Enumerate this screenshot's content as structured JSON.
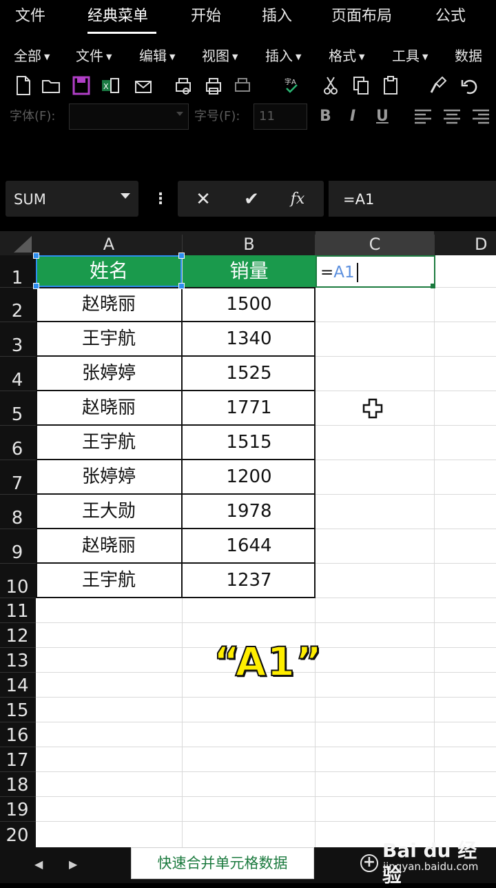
{
  "ribbon": {
    "tabs": [
      "文件",
      "经典菜单",
      "开始",
      "插入",
      "页面布局",
      "公式"
    ],
    "menus": [
      "全部",
      "文件",
      "编辑",
      "视图",
      "插入",
      "格式",
      "工具",
      "数据"
    ],
    "font_label": "字体(F):",
    "size_label": "字号(F):",
    "size_value": "11",
    "format_buttons": [
      "B",
      "I",
      "U"
    ]
  },
  "formula_bar": {
    "name_box": "SUM",
    "cancel": "✕",
    "confirm": "✔",
    "fx": "fx",
    "formula": "=A1"
  },
  "columns": [
    "A",
    "B",
    "C",
    "D"
  ],
  "rows": [
    "1",
    "2",
    "3",
    "4",
    "5",
    "6",
    "7",
    "8",
    "9",
    "10",
    "11",
    "12",
    "13",
    "14",
    "15",
    "16",
    "17",
    "18",
    "19",
    "20"
  ],
  "table": {
    "headers": [
      "姓名",
      "销量"
    ],
    "rows": [
      [
        "赵晓丽",
        "1500"
      ],
      [
        "王宇航",
        "1340"
      ],
      [
        "张婷婷",
        "1525"
      ],
      [
        "赵晓丽",
        "1771"
      ],
      [
        "王宇航",
        "1515"
      ],
      [
        "张婷婷",
        "1200"
      ],
      [
        "王大勋",
        "1978"
      ],
      [
        "赵晓丽",
        "1644"
      ],
      [
        "王宇航",
        "1237"
      ]
    ]
  },
  "editing_cell": {
    "prefix": "=",
    "ref": "A1"
  },
  "annotation": "“A1”",
  "sheet_tab": "快速合并单元格数据",
  "watermark": {
    "logo": "Bai du 经验",
    "site": "jingyan.baidu.com"
  },
  "colors": {
    "header_green": "#1a9a4c",
    "selection_blue": "#2d8ef0",
    "annotation_yellow": "#ffee00"
  }
}
